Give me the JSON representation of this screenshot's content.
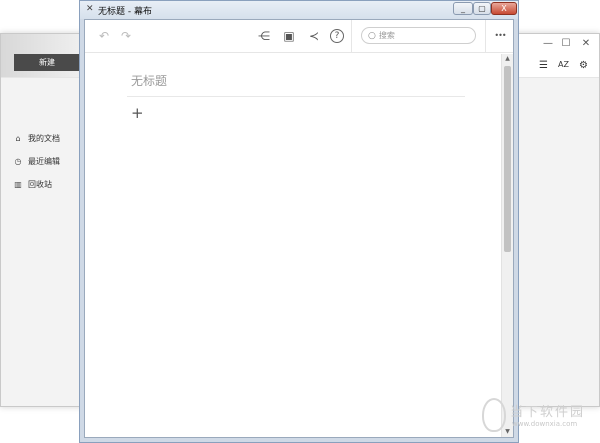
{
  "background_app": {
    "window_controls": {
      "minimize": "—",
      "maximize": "☐",
      "close": "✕"
    },
    "toolbar_icons": [
      "list-icon",
      "sort-az-icon",
      "gear-icon"
    ],
    "toolbar_glyphs": {
      "list": "☰",
      "sort": "AZ",
      "gear": "⚙"
    },
    "new_button_label": "新建",
    "nav_items": [
      {
        "label": "我的文档",
        "icon": "home-icon",
        "glyph": "⌂"
      },
      {
        "label": "最近编辑",
        "icon": "clock-icon",
        "glyph": "◷"
      },
      {
        "label": "回收站",
        "icon": "trash-icon",
        "glyph": "▥"
      }
    ]
  },
  "main_window": {
    "title": "无标题 - 幕布",
    "app_icon_glyph": "✕",
    "window_buttons": {
      "minimize": "_",
      "maximize": "▢",
      "close": "X"
    },
    "toolbar": {
      "undo_glyph": "↶",
      "redo_glyph": "↷",
      "mindmap_glyph": "⋲",
      "present_glyph": "▣",
      "share_glyph": "≺",
      "help_glyph": "?",
      "more_glyph": "•••",
      "search_placeholder": "搜索",
      "search_icon_glyph": "○"
    },
    "document": {
      "title_placeholder": "无标题",
      "add_glyph": "+"
    },
    "scrollbar": {
      "up_glyph": "▲",
      "down_glyph": "▼"
    }
  },
  "watermark": {
    "text": "当下软件园",
    "url": "www.downxia.com"
  },
  "colors": {
    "accent_dark": "#4a4a4a",
    "sidebar_bg": "#f3f3f3",
    "frame": "#cfd9e6"
  }
}
